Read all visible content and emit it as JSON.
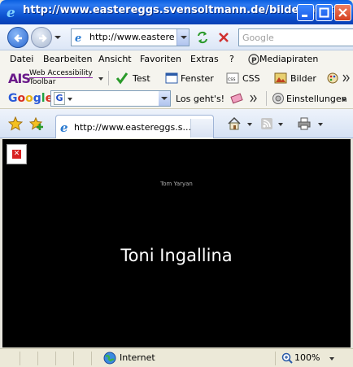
{
  "window": {
    "title": "http://www.eastereggs.svensoltmann.de/bilder/east..."
  },
  "address_bar": {
    "url": "http://www.easteregg",
    "search_placeholder": "Google"
  },
  "menu": {
    "items": [
      "Datei",
      "Bearbeiten",
      "Ansicht",
      "Favoriten",
      "Extras",
      "?"
    ],
    "mediapiraten": "Mediapiraten"
  },
  "ais_toolbar": {
    "logo": "AIS",
    "line1": "Web Accessibility",
    "line2": "Toolbar",
    "test": "Test",
    "fenster": "Fenster",
    "css": "CSS",
    "bilder": "Bilder"
  },
  "google_toolbar": {
    "logo": "Google",
    "go": "Los geht's!",
    "settings": "Einstellungen"
  },
  "tabs": {
    "active_label": "http://www.eastereggs.s..."
  },
  "content": {
    "small_name": "Tom Yaryan",
    "big_name": "Toni Ingallina"
  },
  "status": {
    "zone": "Internet",
    "zoom": "100%"
  },
  "colors": {
    "titlebar": "#0b4fcc",
    "page_bg": "#000000",
    "big_text": "#ffffff"
  }
}
